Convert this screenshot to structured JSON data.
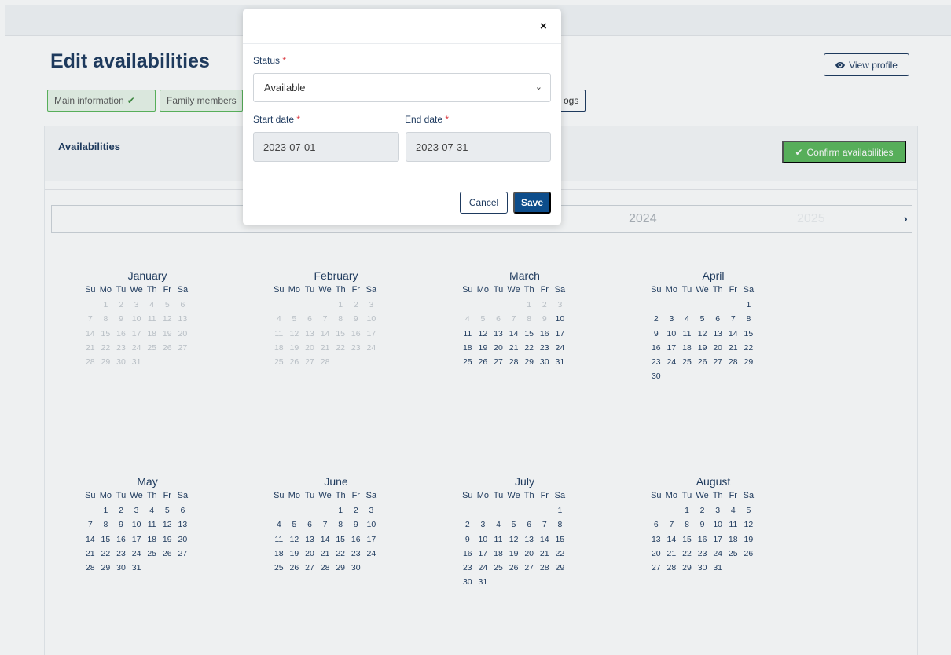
{
  "page": {
    "title": "Edit availabilities",
    "view_profile_label": "View profile",
    "tabs": [
      {
        "label": "Main information",
        "checked": true
      },
      {
        "label": "Family members",
        "checked": false
      },
      {
        "label": "ogs",
        "checked": false
      }
    ]
  },
  "availabilities": {
    "title": "Availabilities",
    "confirm_label": "Confirm availabilities",
    "year_current": "2024",
    "year_next": "2025",
    "next_arrow": "›"
  },
  "calendar": {
    "weekdays": [
      "Su",
      "Mo",
      "Tu",
      "We",
      "Th",
      "Fr",
      "Sa"
    ],
    "months": [
      {
        "name": "January",
        "offset": 1,
        "days": 31,
        "greyed_through": 31
      },
      {
        "name": "February",
        "offset": 4,
        "days": 28,
        "greyed_through": 28
      },
      {
        "name": "March",
        "offset": 4,
        "days": 31,
        "greyed_through": 9
      },
      {
        "name": "April",
        "offset": 6,
        "days": 30,
        "greyed_through": 0
      },
      {
        "name": "May",
        "offset": 1,
        "days": 31,
        "greyed_through": 0
      },
      {
        "name": "June",
        "offset": 4,
        "days": 30,
        "greyed_through": 0
      },
      {
        "name": "July",
        "offset": 6,
        "days": 31,
        "greyed_through": 0
      },
      {
        "name": "August",
        "offset": 2,
        "days": 31,
        "greyed_through": 0
      }
    ]
  },
  "modal": {
    "close_glyph": "×",
    "status_label": "Status",
    "required_mark": "*",
    "status_value": "Available",
    "select_chevron": "⌄",
    "start_label": "Start date",
    "start_value": "2023-07-01",
    "end_label": "End date",
    "end_value": "2023-07-31",
    "cancel_label": "Cancel",
    "save_label": "Save"
  },
  "icons": {
    "view_profile": "eye-icon",
    "tab_check": "check-icon",
    "confirm": "check-icon",
    "close": "close-icon"
  },
  "colors": {
    "primary": "#1e3a5f",
    "success": "#5cb85c",
    "save": "#0d4d8b",
    "required": "#d9363e"
  }
}
